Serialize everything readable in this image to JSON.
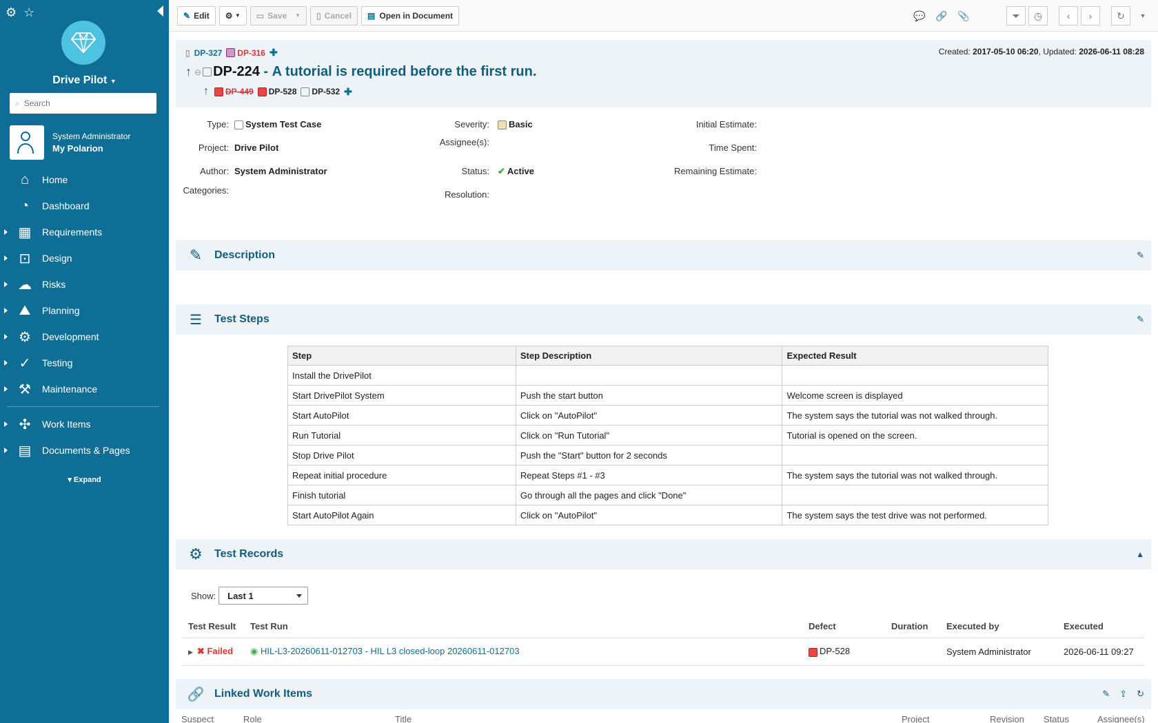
{
  "sidebar": {
    "project_name": "Drive Pilot",
    "search_placeholder": "Search",
    "user_role": "System Administrator",
    "user_link": "My Polarion",
    "nav": [
      {
        "label": "Home",
        "icon": "home-icon",
        "expandable": false
      },
      {
        "label": "Dashboard",
        "icon": "dashboard-icon",
        "expandable": false
      },
      {
        "label": "Requirements",
        "icon": "requirements-icon",
        "expandable": true
      },
      {
        "label": "Design",
        "icon": "design-icon",
        "expandable": true
      },
      {
        "label": "Risks",
        "icon": "risks-icon",
        "expandable": true
      },
      {
        "label": "Planning",
        "icon": "planning-icon",
        "expandable": true
      },
      {
        "label": "Development",
        "icon": "development-icon",
        "expandable": true
      },
      {
        "label": "Testing",
        "icon": "testing-icon",
        "expandable": true
      },
      {
        "label": "Maintenance",
        "icon": "maintenance-icon",
        "expandable": true
      },
      {
        "label": "Work Items",
        "icon": "work-items-icon",
        "expandable": true
      },
      {
        "label": "Documents & Pages",
        "icon": "documents-icon",
        "expandable": true
      }
    ],
    "expand_label": "Expand"
  },
  "toolbar": {
    "edit": "Edit",
    "save": "Save",
    "cancel": "Cancel",
    "open_in_document": "Open in Document"
  },
  "header": {
    "parent_links": [
      "DP-327",
      "DP-316"
    ],
    "created_label": "Created:",
    "created": "2017-05-10 06:20",
    "updated_label": "Updated:",
    "updated": "2026-06-11 08:28",
    "id": "DP-224",
    "separator": " - ",
    "title": "A tutorial is required before the first run.",
    "child_links": [
      "DP-449",
      "DP-528",
      "DP-532"
    ]
  },
  "fields": {
    "type_label": "Type:",
    "type": "System Test Case",
    "project_label": "Project:",
    "project": "Drive Pilot",
    "author_label": "Author:",
    "author": "System Administrator",
    "categories_label": "Categories:",
    "severity_label": "Severity:",
    "severity": "Basic",
    "assignees_label": "Assignee(s):",
    "status_label": "Status:",
    "status": "Active",
    "resolution_label": "Resolution:",
    "initial_estimate_label": "Initial Estimate:",
    "time_spent_label": "Time Spent:",
    "remaining_estimate_label": "Remaining Estimate:"
  },
  "sections": {
    "description": "Description",
    "test_steps": "Test Steps",
    "test_records": "Test Records",
    "linked_work_items": "Linked Work Items"
  },
  "test_steps": {
    "headers": [
      "Step",
      "Step Description",
      "Expected Result"
    ],
    "rows": [
      [
        "Install the DrivePilot",
        "",
        ""
      ],
      [
        "Start DrivePilot System",
        "Push the start button",
        "Welcome screen is displayed"
      ],
      [
        "Start AutoPilot",
        "Click on \"AutoPilot\"",
        "The system says the tutorial was not walked through."
      ],
      [
        "Run Tutorial",
        "Click on \"Run Tutorial\"",
        "Tutorial is opened on the screen."
      ],
      [
        "Stop Drive Pilot",
        "Push the \"Start\" button for 2 seconds",
        ""
      ],
      [
        "Repeat initial procedure",
        "Repeat Steps #1 - #3",
        "The system says the tutorial was not walked through."
      ],
      [
        "Finish tutorial",
        "Go through all the pages and click \"Done\"",
        ""
      ],
      [
        "Start AutoPilot Again",
        "Click on \"AutoPilot\"",
        "The system says the test drive was not performed."
      ]
    ]
  },
  "test_records": {
    "show_label": "Show:",
    "show_value": "Last 1",
    "headers": [
      "Test Result",
      "Test Run",
      "Defect",
      "Duration",
      "Executed by",
      "Executed"
    ],
    "rows": [
      {
        "result": "Failed",
        "run": "HIL-L3-20260611-012703 - HIL L3 closed-loop 20260611-012703",
        "defect": "DP-528",
        "duration": "",
        "executed_by": "System Administrator",
        "executed": "2026-06-11 09:27"
      }
    ]
  },
  "linked_work_items": {
    "headers": [
      "Suspect",
      "Role",
      "Title",
      "Project",
      "Revision",
      "Status",
      "Assignee(s)"
    ]
  },
  "colors": {
    "sidebar": "#0f6e96",
    "accent": "#0f5e80",
    "failed": "#dd3333",
    "section_bg": "#eef3f7"
  }
}
